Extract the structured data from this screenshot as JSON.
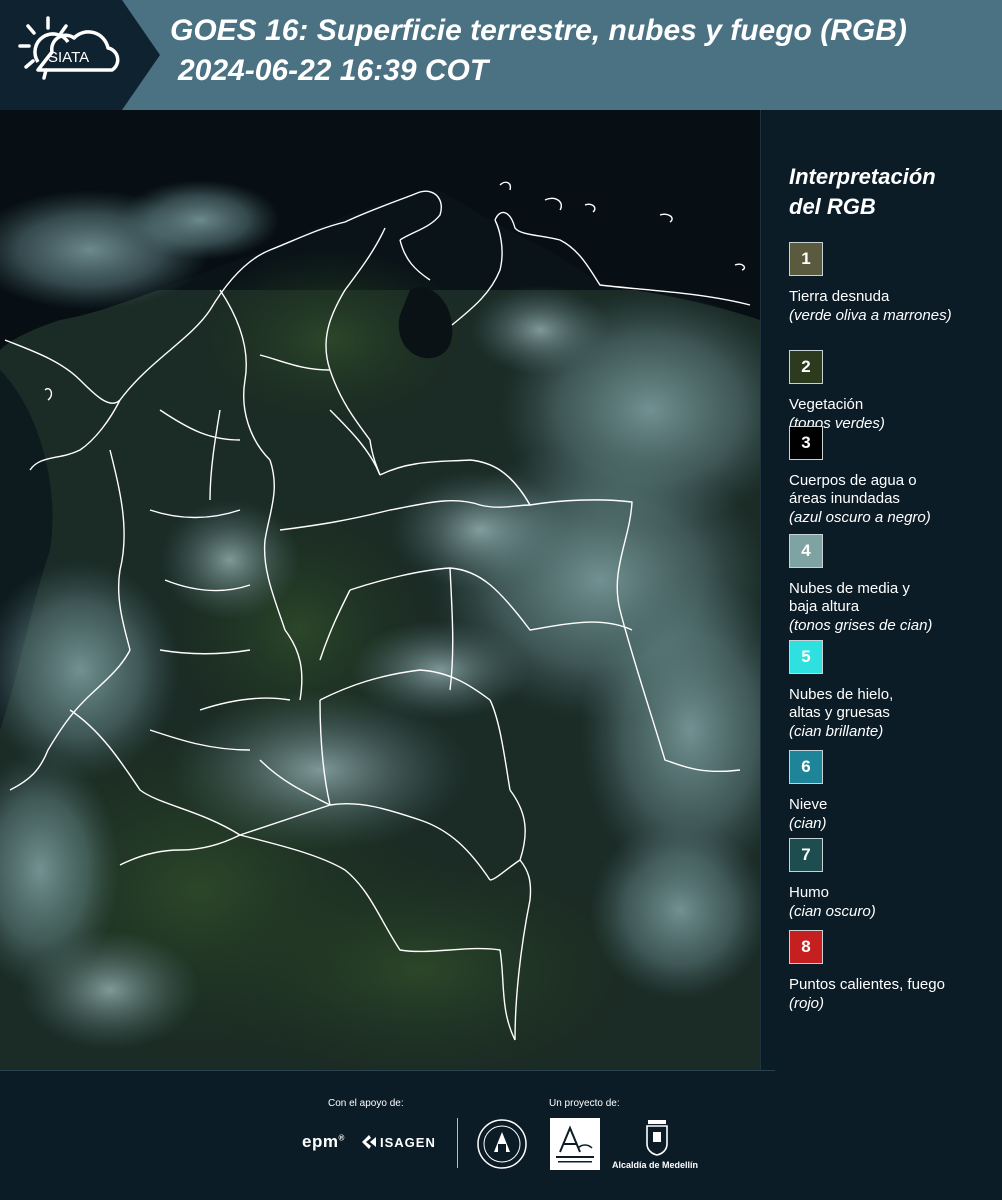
{
  "header": {
    "logo_text": "SIATA",
    "title_line1": "GOES 16: Superficie terrestre, nubes y fuego (RGB)",
    "title_line2": "2024-06-22 16:39 COT",
    "bg_color": "#4a7283"
  },
  "legend": {
    "title_line1": "Interpretación",
    "title_line2": "del RGB",
    "items": [
      {
        "number": "1",
        "label_lines": [
          "Tierra desnuda"
        ],
        "note": "(verde oliva a marrones)",
        "color": "#5a5a3e"
      },
      {
        "number": "2",
        "label_lines": [
          "Vegetación"
        ],
        "note": "(tonos verdes)",
        "color": "#2c3a1e"
      },
      {
        "number": "3",
        "label_lines": [
          "Cuerpos de agua o",
          "áreas inundadas"
        ],
        "note": "(azul oscuro a negro)",
        "color": "#000000"
      },
      {
        "number": "4",
        "label_lines": [
          "Nubes de media y",
          "baja altura"
        ],
        "note": "(tonos grises de cian)",
        "color": "#7fa3a3"
      },
      {
        "number": "5",
        "label_lines": [
          "Nubes de hielo,",
          "altas y gruesas"
        ],
        "note": "(cian brillante)",
        "color": "#2fe0e0"
      },
      {
        "number": "6",
        "label_lines": [
          "Nieve"
        ],
        "note": "(cian)",
        "color": "#1e8598"
      },
      {
        "number": "7",
        "label_lines": [
          "Humo"
        ],
        "note": "(cian oscuro)",
        "color": "#1d4d4f"
      },
      {
        "number": "8",
        "label_lines": [
          "Puntos calientes, fuego"
        ],
        "note": "(rojo)",
        "color": "#c61f1f"
      }
    ]
  },
  "footer": {
    "support_label": "Con el apoyo de:",
    "project_label": "Un proyecto de:",
    "sponsor_epm": "epm",
    "sponsor_isagen": "ISAGEN",
    "partner_metro": "Área Metropolitana Valle de Aburrá",
    "partner_medellin": "Alcaldía de Medellín"
  }
}
